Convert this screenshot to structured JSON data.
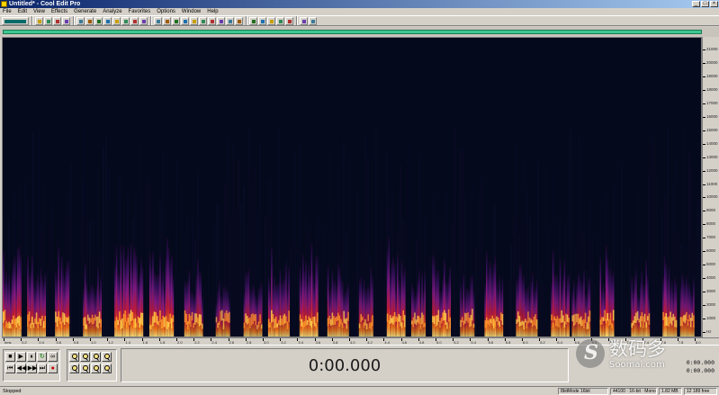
{
  "window": {
    "title": "Untitled* - Cool Edit Pro",
    "buttons": [
      "_",
      "□",
      "×"
    ]
  },
  "menu": [
    "File",
    "Edit",
    "View",
    "Effects",
    "Generate",
    "Analyze",
    "Favorites",
    "Options",
    "Window",
    "Help"
  ],
  "toolbar": {
    "icons": [
      "waveform-view-icon",
      "open-icon",
      "save-icon",
      "record-icon",
      "effects-icon",
      "cut-icon",
      "copy-icon",
      "paste-icon",
      "mix-paste-icon",
      "trim-icon",
      "undo-icon",
      "redo-icon",
      "repeat-icon",
      "spectral-view-icon",
      "frequency-analysis-icon",
      "envelope-icon",
      "normalize-icon",
      "reverse-icon",
      "silence-icon",
      "invert-icon",
      "fade-icon",
      "bend-icon",
      "pitch-icon",
      "stretch-icon",
      "filter-icon",
      "delay-icon",
      "reverb-icon",
      "chorus-icon",
      "settings-icon",
      "info-icon"
    ]
  },
  "colors": {
    "spectral_bg": "#05091c",
    "overview_bar": "#3dc890",
    "title_bar": "#0a246a"
  },
  "frequency_axis": {
    "labels": [
      "21000",
      "20000",
      "19000",
      "18000",
      "17000",
      "16000",
      "15000",
      "14000",
      "13000",
      "12000",
      "11000",
      "10000",
      "9000",
      "8000",
      "7000",
      "6000",
      "5000",
      "4000",
      "3000",
      "2000",
      "1000",
      "Hz"
    ]
  },
  "time_axis": {
    "labels": [
      "hms",
      "0.2",
      "0.4",
      "0.6",
      "0.8",
      "1.0",
      "1.2",
      "1.4",
      "1.6",
      "1.8",
      "2.0",
      "2.2",
      "2.4",
      "2.6",
      "2.8",
      "3.0",
      "3.2",
      "3.4",
      "3.6",
      "3.8",
      "4.0",
      "4.2",
      "4.4",
      "4.6",
      "4.8",
      "5.0",
      "5.2",
      "5.4",
      "5.6",
      "5.8",
      "6.0",
      "6.2",
      "6.4",
      "6.6",
      "6.8",
      "7.0",
      "7.2",
      "7.4",
      "7.6",
      "7.8",
      "8.0"
    ]
  },
  "transport": {
    "row1": [
      "■",
      "▶",
      "⏸",
      "↻",
      "∞"
    ],
    "row2": [
      "⏮",
      "◀◀",
      "▶▶",
      "⏭",
      "●"
    ],
    "zoom_icons": [
      "zoom-in-icon",
      "zoom-out-icon",
      "zoom-full-icon",
      "zoom-selection-icon",
      "zoom-left-icon",
      "zoom-right-icon",
      "zoom-vertical-in-icon",
      "zoom-vertical-out-icon"
    ]
  },
  "time_display": "0:00.000",
  "selection": {
    "begin": "0:00.000",
    "end": "0:00.000"
  },
  "watermark": {
    "cn": "数码多",
    "url": "Soomal.com"
  },
  "status": {
    "state": "Stopped",
    "cells": [
      "8bitMode  16bit",
      "44100 · 16-bit · Mono",
      "1.82 MB",
      "12 189 free"
    ]
  },
  "spectrogram": {
    "description_free_bursts": [
      {
        "start": 0.0,
        "end": 0.025,
        "energy": 0.9
      },
      {
        "start": 0.035,
        "end": 0.06,
        "energy": 0.8
      },
      {
        "start": 0.075,
        "end": 0.095,
        "energy": 0.9
      },
      {
        "start": 0.115,
        "end": 0.14,
        "energy": 0.7
      },
      {
        "start": 0.16,
        "end": 0.2,
        "energy": 1.0
      },
      {
        "start": 0.21,
        "end": 0.245,
        "energy": 0.9
      },
      {
        "start": 0.26,
        "end": 0.285,
        "energy": 0.7
      },
      {
        "start": 0.305,
        "end": 0.325,
        "energy": 0.5
      },
      {
        "start": 0.345,
        "end": 0.37,
        "energy": 0.6
      },
      {
        "start": 0.38,
        "end": 0.41,
        "energy": 0.8
      },
      {
        "start": 0.425,
        "end": 0.45,
        "energy": 0.9
      },
      {
        "start": 0.465,
        "end": 0.495,
        "energy": 0.7
      },
      {
        "start": 0.51,
        "end": 0.53,
        "energy": 0.6
      },
      {
        "start": 0.55,
        "end": 0.575,
        "energy": 0.9
      },
      {
        "start": 0.585,
        "end": 0.605,
        "energy": 0.7
      },
      {
        "start": 0.615,
        "end": 0.64,
        "energy": 0.8
      },
      {
        "start": 0.655,
        "end": 0.675,
        "energy": 0.6
      },
      {
        "start": 0.69,
        "end": 0.715,
        "energy": 0.9
      },
      {
        "start": 0.735,
        "end": 0.765,
        "energy": 0.7
      },
      {
        "start": 0.785,
        "end": 0.81,
        "energy": 0.8
      },
      {
        "start": 0.815,
        "end": 0.84,
        "energy": 0.6
      },
      {
        "start": 0.855,
        "end": 0.875,
        "energy": 0.9
      },
      {
        "start": 0.9,
        "end": 0.925,
        "energy": 0.7
      },
      {
        "start": 0.945,
        "end": 0.965,
        "energy": 0.8
      },
      {
        "start": 0.97,
        "end": 0.99,
        "energy": 0.7
      }
    ]
  }
}
